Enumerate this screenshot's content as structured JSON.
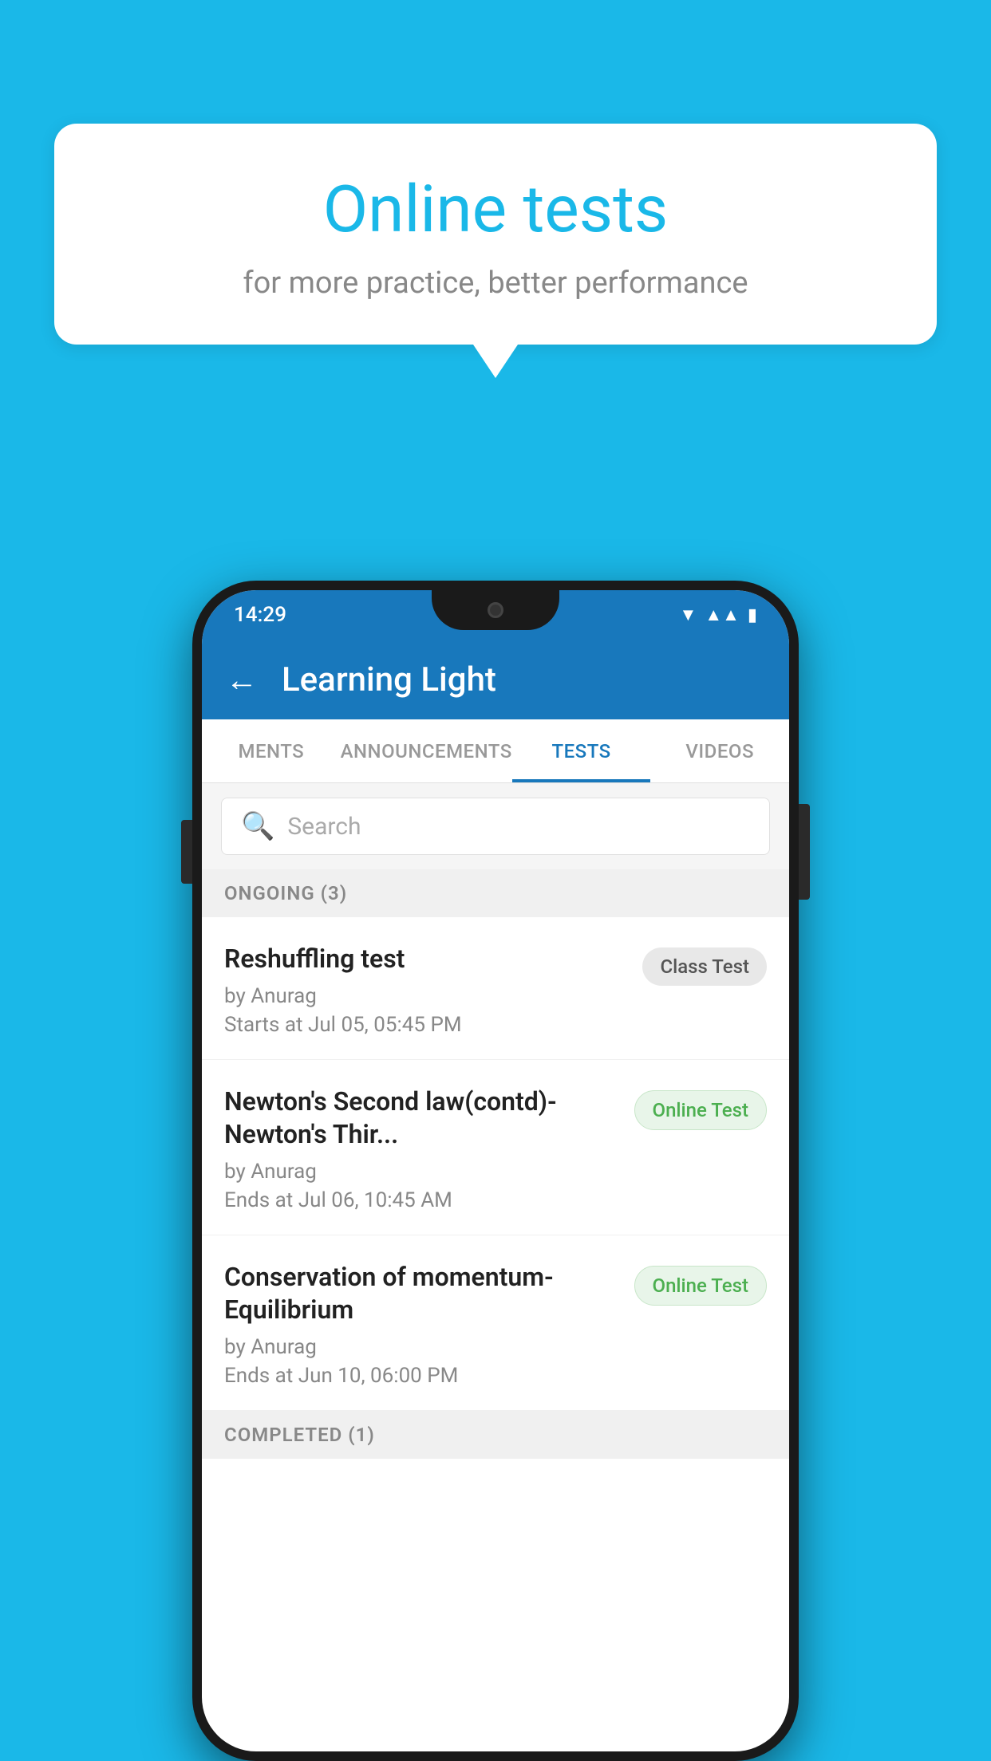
{
  "background_color": "#1ab8e8",
  "speech_bubble": {
    "title": "Online tests",
    "subtitle": "for more practice, better performance"
  },
  "phone": {
    "status_bar": {
      "time": "14:29",
      "wifi": "▼",
      "signal": "▲",
      "battery": "▮"
    },
    "app_bar": {
      "back_label": "←",
      "title": "Learning Light"
    },
    "tabs": [
      {
        "label": "MENTS",
        "active": false
      },
      {
        "label": "ANNOUNCEMENTS",
        "active": false
      },
      {
        "label": "TESTS",
        "active": true
      },
      {
        "label": "VIDEOS",
        "active": false
      }
    ],
    "search": {
      "placeholder": "Search"
    },
    "ongoing_section": {
      "label": "ONGOING (3)"
    },
    "tests": [
      {
        "title": "Reshuffling test",
        "author": "by Anurag",
        "time_label": "Starts at  Jul 05, 05:45 PM",
        "badge": "Class Test",
        "badge_type": "class"
      },
      {
        "title": "Newton's Second law(contd)-Newton's Thir...",
        "author": "by Anurag",
        "time_label": "Ends at  Jul 06, 10:45 AM",
        "badge": "Online Test",
        "badge_type": "online"
      },
      {
        "title": "Conservation of momentum-Equilibrium",
        "author": "by Anurag",
        "time_label": "Ends at  Jun 10, 06:00 PM",
        "badge": "Online Test",
        "badge_type": "online"
      }
    ],
    "completed_section": {
      "label": "COMPLETED (1)"
    }
  }
}
